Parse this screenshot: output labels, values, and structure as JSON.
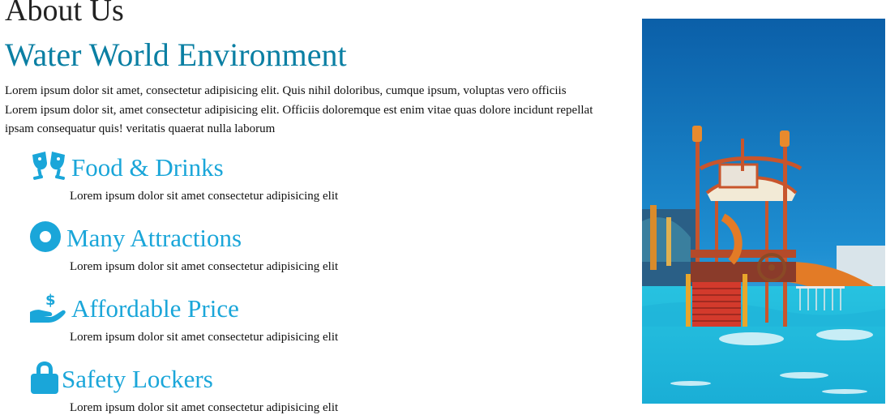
{
  "about": {
    "heading": "About Us",
    "title": "Water World Environment",
    "intro": "Lorem ipsum dolor sit amet, consectetur adipisicing elit. Quis nihil doloribus, cumque ipsum, voluptas vero officiis Lorem ipsum dolor sit, amet consectetur adipisicing elit. Officiis doloremque est enim vitae quas dolore incidunt repellat ipsam consequatur quis! veritatis quaerat nulla laborum"
  },
  "features": [
    {
      "icon": "glasses-cheers-icon",
      "title": "Food & Drinks",
      "description": "Lorem ipsum dolor sit amet consectetur adipisicing elit"
    },
    {
      "icon": "circle-dot-icon",
      "title": "Many Attractions",
      "description": "Lorem ipsum dolor sit amet consectetur adipisicing elit"
    },
    {
      "icon": "hand-holding-dollar-icon",
      "title": "Affordable Price",
      "description": "Lorem ipsum dolor sit amet consectetur adipisicing elit"
    },
    {
      "icon": "lock-icon",
      "title": "Safety Lockers",
      "description": "Lorem ipsum dolor sit amet consectetur adipisicing elit"
    }
  ],
  "colors": {
    "title": "#0a7fa3",
    "accent": "#1aa6d9",
    "pool_water": "#23b9d6",
    "sky": "#0a72b5"
  },
  "photo": {
    "subject": "water-park-playground-photo"
  }
}
